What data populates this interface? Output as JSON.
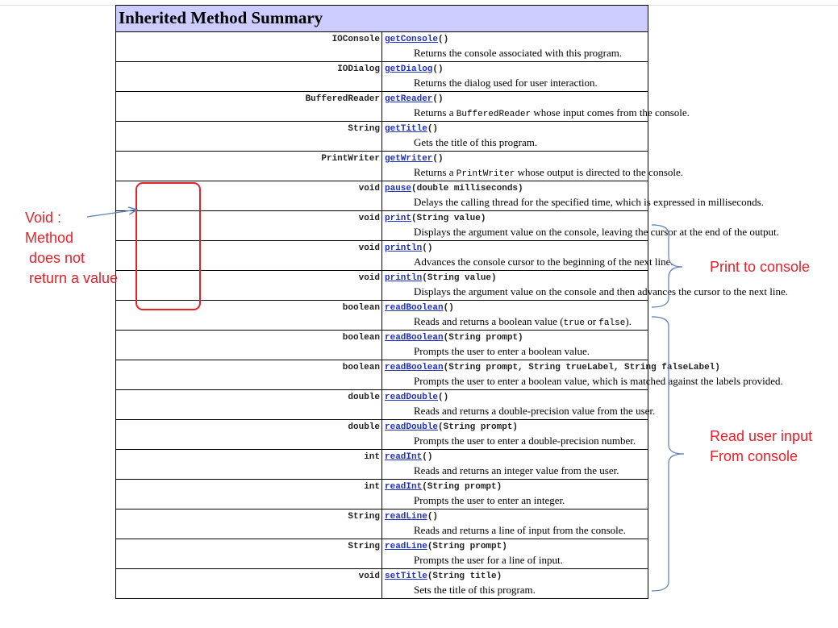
{
  "header": {
    "title": "Inherited Method Summary"
  },
  "methods": [
    {
      "type": "IOConsole",
      "name": "getConsole",
      "params": "()",
      "desc": [
        "Returns the console associated with this program."
      ]
    },
    {
      "type": "IODialog",
      "name": "getDialog",
      "params": "()",
      "desc": [
        "Returns the dialog used for user interaction."
      ]
    },
    {
      "type": "BufferedReader",
      "name": "getReader",
      "params": "()",
      "desc": [
        "Returns a ",
        "BufferedReader",
        " whose input comes from the console."
      ]
    },
    {
      "type": "String",
      "name": "getTitle",
      "params": "()",
      "desc": [
        "Gets the title of this program."
      ]
    },
    {
      "type": "PrintWriter",
      "name": "getWriter",
      "params": "()",
      "desc": [
        "Returns a ",
        "PrintWriter",
        " whose output is directed to the console."
      ]
    },
    {
      "type": "void",
      "name": "pause",
      "params": "(double milliseconds)",
      "desc": [
        "Delays the calling thread for the specified time, which is expressed in milliseconds."
      ]
    },
    {
      "type": "void",
      "name": "print",
      "params": "(String value)",
      "desc": [
        "Displays the argument value on the console, leaving the cursor at the end of the output."
      ]
    },
    {
      "type": "void",
      "name": "println",
      "params": "()",
      "desc": [
        "Advances the console cursor to the beginning of the next line."
      ]
    },
    {
      "type": "void",
      "name": "println",
      "params": "(String value)",
      "desc": [
        "Displays the argument value on the console and then advances the cursor to the next line."
      ]
    },
    {
      "type": "boolean",
      "name": "readBoolean",
      "params": "()",
      "desc": [
        "Reads and returns a boolean value (",
        "true",
        " or ",
        "false",
        ")."
      ]
    },
    {
      "type": "boolean",
      "name": "readBoolean",
      "params": "(String prompt)",
      "desc": [
        "Prompts the user to enter a boolean value."
      ]
    },
    {
      "type": "boolean",
      "name": "readBoolean",
      "params": "(String prompt, String trueLabel, String falseLabel)",
      "desc": [
        "Prompts the user to enter a boolean value, which is matched against the labels provided."
      ]
    },
    {
      "type": "double",
      "name": "readDouble",
      "params": "()",
      "desc": [
        "Reads and returns a double-precision value from the user."
      ]
    },
    {
      "type": "double",
      "name": "readDouble",
      "params": "(String prompt)",
      "desc": [
        "Prompts the user to enter a double-precision number."
      ]
    },
    {
      "type": "int",
      "name": "readInt",
      "params": "()",
      "desc": [
        "Reads and returns an integer value from the user."
      ]
    },
    {
      "type": "int",
      "name": "readInt",
      "params": "(String prompt)",
      "desc": [
        "Prompts the user to enter an integer."
      ]
    },
    {
      "type": "String",
      "name": "readLine",
      "params": "()",
      "desc": [
        "Reads and returns a line of input from the console."
      ]
    },
    {
      "type": "String",
      "name": "readLine",
      "params": "(String prompt)",
      "desc": [
        "Prompts the user for a line of input."
      ]
    },
    {
      "type": "void",
      "name": "setTitle",
      "params": "(String title)",
      "desc": [
        "Sets the title of this program."
      ]
    }
  ],
  "annotations": {
    "void_note": [
      "Void :",
      "Method",
      "does not",
      "return a value"
    ],
    "print_note": "Print to console",
    "read_note": [
      "Read user input",
      "From console"
    ]
  },
  "colors": {
    "header_bg": "#ccccff",
    "link": "#1f2fbf",
    "annotation_red": "#e8202a",
    "bracket_blue": "#5b7fb5"
  }
}
